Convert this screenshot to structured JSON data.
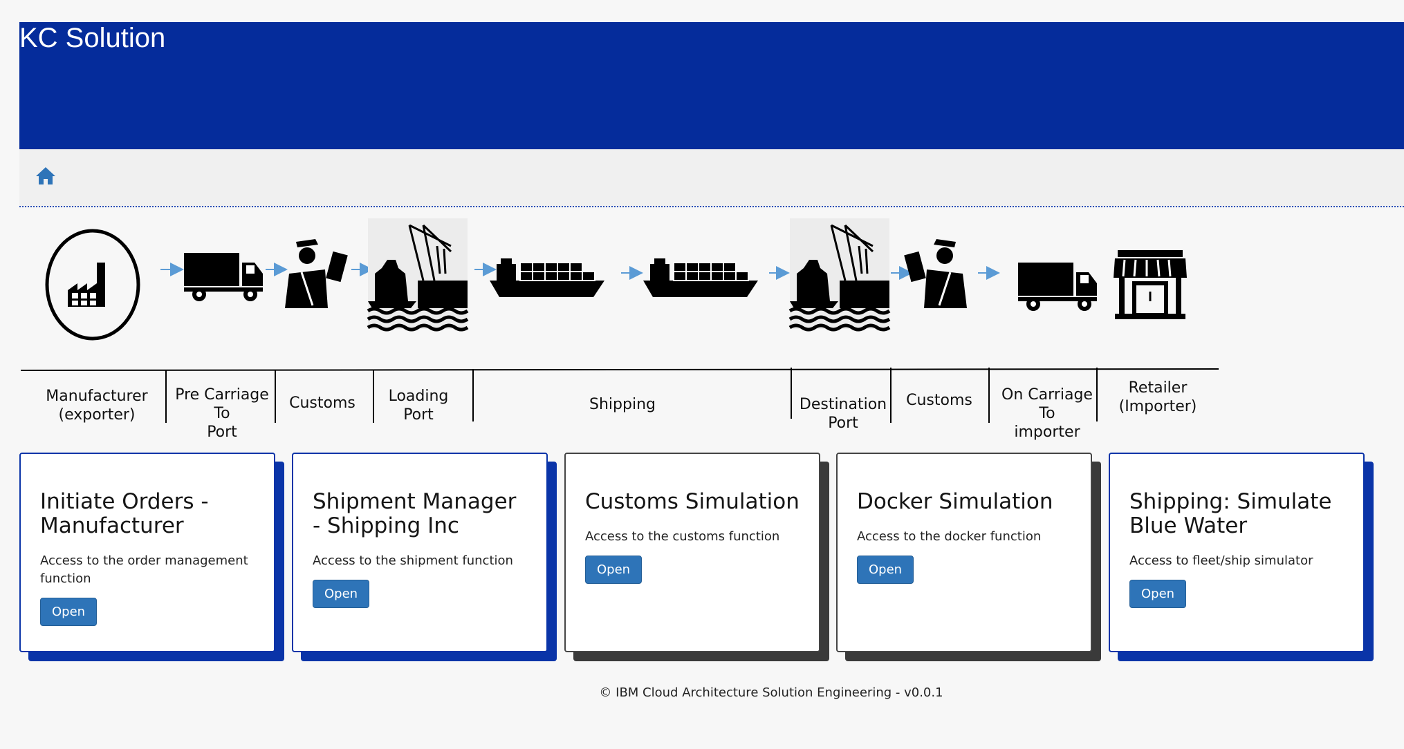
{
  "app": {
    "title": "KC Solution"
  },
  "toolbar": {
    "home_icon": "home-icon"
  },
  "diagram": {
    "stages": [
      {
        "label": "Manufacturer\n(exporter)",
        "icon": "factory-icon"
      },
      {
        "label": "Pre Carriage\nTo\nPort",
        "icon": "truck-icon"
      },
      {
        "label": "Customs",
        "icon": "customs-officer-icon"
      },
      {
        "label": "Loading\nPort",
        "icon": "port-crane-icon"
      },
      {
        "label": "Shipping",
        "icon": "container-ship-icon"
      },
      {
        "label": "Destination\nPort",
        "icon": "port-crane-icon"
      },
      {
        "label": "Customs",
        "icon": "customs-officer-icon"
      },
      {
        "label": "On Carriage\nTo\nimporter",
        "icon": "truck-icon"
      },
      {
        "label": "Retailer\n(Importer)",
        "icon": "store-icon"
      }
    ],
    "arrow_color": "#5b9bd5"
  },
  "cards": [
    {
      "title": "Initiate Orders - Manufacturer",
      "desc": "Access to the order management function",
      "button": "Open"
    },
    {
      "title": "Shipment Manager - Shipping Inc",
      "desc": "Access to the shipment function",
      "button": "Open"
    },
    {
      "title": "Customs Simulation",
      "desc": "Access to the customs function",
      "button": "Open"
    },
    {
      "title": "Docker Simulation",
      "desc": "Access to the docker function",
      "button": "Open"
    },
    {
      "title": "Shipping: Simulate Blue Water",
      "desc": "Access to fleet/ship simulator",
      "button": "Open"
    }
  ],
  "footer": {
    "text": "© IBM Cloud Architecture Solution Engineering - v0.0.1"
  },
  "colors": {
    "header": "#052c9b",
    "button": "#2e74b8"
  }
}
